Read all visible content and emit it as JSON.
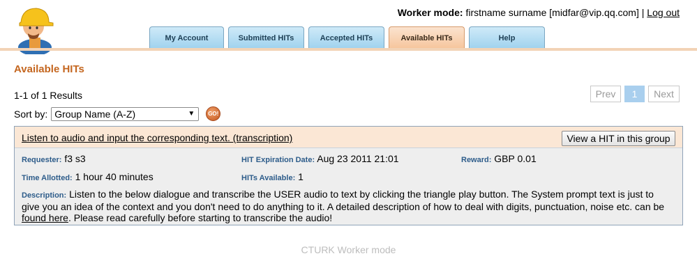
{
  "header": {
    "mode_label": "Worker mode:",
    "user_text": "firstname surname [midfar@vip.qq.com]",
    "separator": "|",
    "logout_label": "Log out"
  },
  "tabs": [
    {
      "label": "My Account"
    },
    {
      "label": "Submitted HITs"
    },
    {
      "label": "Accepted HITs"
    },
    {
      "label": "Available HITs",
      "active": true
    },
    {
      "label": "Help"
    }
  ],
  "page_title": "Available HITs",
  "results": {
    "count_text": "1-1 of 1 Results",
    "prev_label": "Prev",
    "current_page": "1",
    "next_label": "Next"
  },
  "sort": {
    "label": "Sort by:",
    "selected": "Group Name (A-Z)",
    "go_label": "GO!"
  },
  "hit_group": {
    "title": "Listen to audio and input the corresponding text. (transcription)",
    "view_button": "View a HIT in this group",
    "requester_label": "Requester:",
    "requester_value": "f3 s3",
    "expiration_label": "HIT Expiration Date:",
    "expiration_value": "Aug 23 2011 21:01",
    "reward_label": "Reward:",
    "reward_value": "GBP 0.01",
    "time_label": "Time Allotted:",
    "time_value": "1 hour 40 minutes",
    "available_label": "HITs Available:",
    "available_value": "1",
    "description_label": "Description:",
    "description_text": "Listen to the below dialogue and transcribe the USER audio to text by clicking the triangle play button. The System prompt text is just to give you an idea of the context and you don't need to do anything to it. A detailed description of how to deal with digits, punctuation, noise etc. can be",
    "description_link": "found here",
    "description_tail": ". Please read carefully before starting to transcribe the audio!"
  },
  "footer": "CTURK Worker mode",
  "colors": {
    "accent": "#c4661f",
    "tab_blue": "#9fd2ee",
    "tab_active": "#f6c59c",
    "label_blue": "#2d5c8a"
  }
}
